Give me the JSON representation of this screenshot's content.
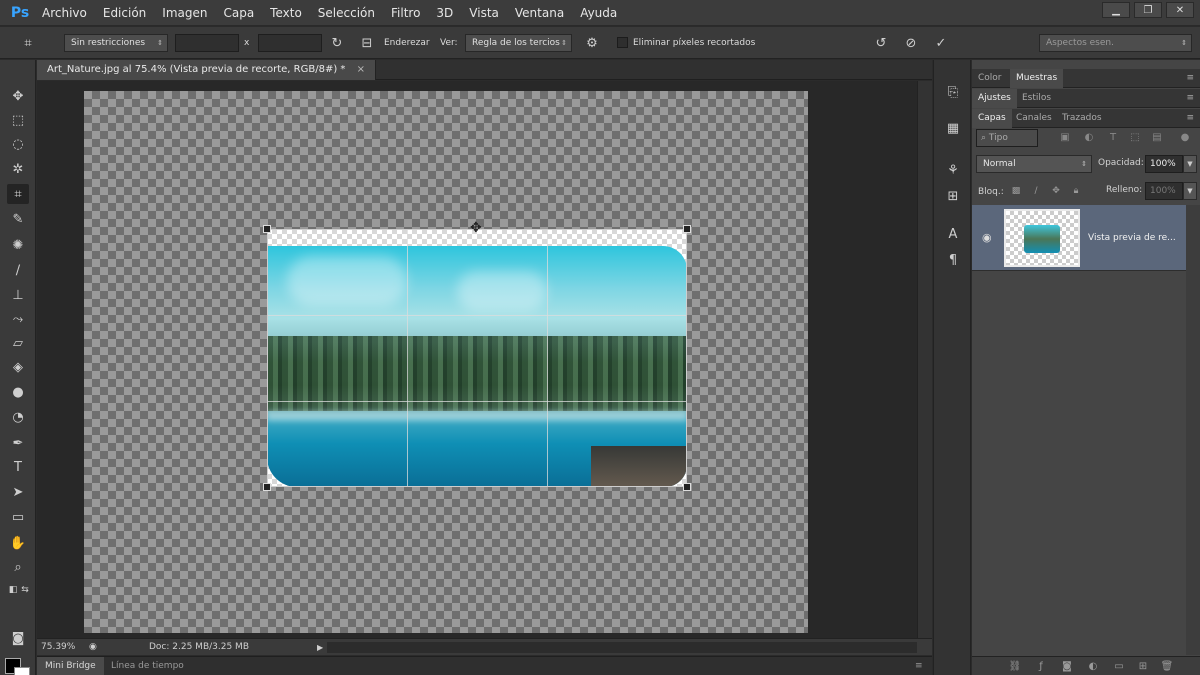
{
  "app": {
    "logo": "Ps"
  },
  "menu": [
    "Archivo",
    "Edición",
    "Imagen",
    "Capa",
    "Texto",
    "Selección",
    "Filtro",
    "3D",
    "Vista",
    "Ventana",
    "Ayuda"
  ],
  "window_controls": {
    "minimize": "▁",
    "restore": "❐",
    "close": "✕"
  },
  "options": {
    "ratio_preset": "Sin restricciones",
    "ratio_separator": "x",
    "straighten_label": "Enderezar",
    "view_label": "Ver:",
    "overlay": "Regla de los tercios",
    "delete_cropped_label": "Eliminar píxeles recortados",
    "workspace": "Aspectos esen."
  },
  "document": {
    "tab_title": "Art_Nature.jpg al 75.4% (Vista previa de recorte, RGB/8#) *",
    "tab_close": "×"
  },
  "status": {
    "zoom": "75.39%",
    "doc_size": "Doc: 2.25 MB/3.25 MB"
  },
  "bottom_tabs": {
    "mini_bridge": "Mini Bridge",
    "timeline": "Línea de tiempo"
  },
  "panels": {
    "top_tabs": [
      "Color",
      "Muestras"
    ],
    "adjust_tabs": [
      "Ajustes",
      "Estilos"
    ],
    "layer_tabs": [
      "Capas",
      "Canales",
      "Trazados"
    ],
    "filter_kind": "Tipo",
    "blend_mode": "Normal",
    "opacity_label": "Opacidad:",
    "opacity_value": "100%",
    "lock_label": "Bloq.:",
    "fill_label": "Relleno:",
    "fill_value": "100%",
    "layer_name": "Vista previa de re..."
  }
}
